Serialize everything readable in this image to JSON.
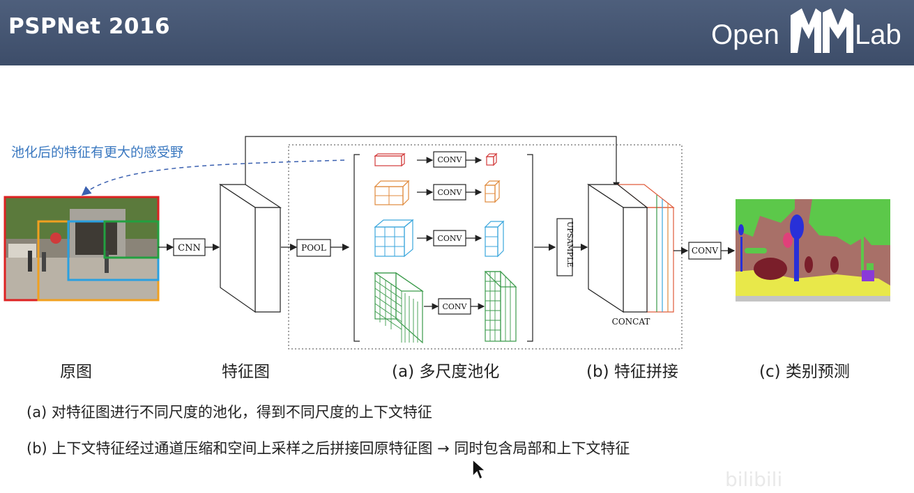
{
  "header": {
    "title": "PSPNet 2016",
    "logo": {
      "left_text": "Open",
      "middle_mark": "MM",
      "right_text": "Lab"
    }
  },
  "annotation": "池化后的特征有更大的感受野",
  "blocks": {
    "cnn": "CNN",
    "pool": "POOL",
    "conv": "CONV",
    "upsample": "UPSAMPLE",
    "concat": "CONCAT",
    "final_conv": "CONV"
  },
  "captions": {
    "original": "原图",
    "feature_map": "特征图",
    "multiscale_pooling": "(a) 多尺度池化",
    "feature_concat": "(b) 特征拼接",
    "class_prediction": "(c) 类别预测"
  },
  "notes": [
    "(a) 对特征图进行不同尺度的池化，得到不同尺度的上下文特征",
    "(b) 上下文特征经过通道压缩和空间上采样之后拼接回原特征图 → 同时包含局部和上下文特征"
  ],
  "watermark": "bilibili",
  "colors": {
    "header_bg": "#45556f",
    "annotation": "#3a78c0",
    "pool_red": "#d23a3a",
    "pool_orange": "#e08a3c",
    "pool_blue": "#3aa6dc",
    "pool_green": "#3a9a4a",
    "seg_green": "#5cc84a",
    "seg_brown": "#a87068",
    "seg_yellow": "#e8e84a",
    "seg_darkred": "#7a1e2a",
    "seg_blue": "#2830d8",
    "seg_pink": "#e0407a"
  },
  "icons": [
    "mouse-cursor-icon",
    "arrow-icon"
  ]
}
